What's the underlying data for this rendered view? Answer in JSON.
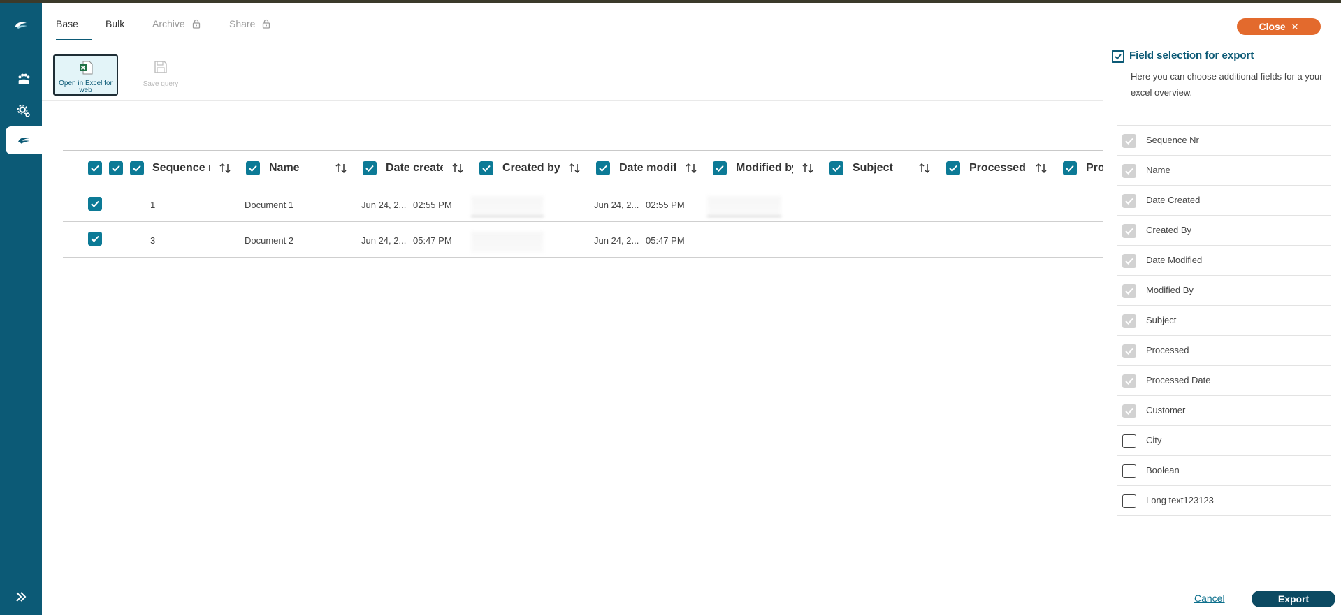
{
  "tabs": [
    {
      "label": "Base",
      "state": "active"
    },
    {
      "label": "Bulk",
      "state": "normal"
    },
    {
      "label": "Archive",
      "state": "locked"
    },
    {
      "label": "Share",
      "state": "locked"
    }
  ],
  "toolbar": {
    "open_excel_label": "Open in Excel for web",
    "save_query_label": "Save query"
  },
  "close_button": {
    "label": "Close",
    "icon": "close-icon"
  },
  "table": {
    "headers": [
      "Sequence n",
      "Name",
      "Date create",
      "Created by",
      "Date modif",
      "Modified by",
      "Subject",
      "Processed",
      "Pro"
    ],
    "rows": [
      {
        "sequence": "1",
        "name": "Document 1",
        "date_created": "Jun 24, 2...",
        "time_created": "02:55 PM",
        "date_modified": "Jun 24, 2...",
        "time_modified": "02:55 PM"
      },
      {
        "sequence": "3",
        "name": "Document 2",
        "date_created": "Jun 24, 2...",
        "time_created": "05:47 PM",
        "date_modified": "Jun 24, 2...",
        "time_modified": "05:47 PM"
      }
    ]
  },
  "panel": {
    "title": "Field selection for export",
    "description": "Here you can choose additional fields for a your excel overview.",
    "fields": [
      {
        "label": "Sequence Nr",
        "checked": true,
        "locked": true
      },
      {
        "label": "Name",
        "checked": true,
        "locked": true
      },
      {
        "label": "Date Created",
        "checked": true,
        "locked": true
      },
      {
        "label": "Created By",
        "checked": true,
        "locked": true
      },
      {
        "label": "Date Modified",
        "checked": true,
        "locked": true
      },
      {
        "label": "Modified By",
        "checked": true,
        "locked": true
      },
      {
        "label": "Subject",
        "checked": true,
        "locked": true
      },
      {
        "label": "Processed",
        "checked": true,
        "locked": true
      },
      {
        "label": "Processed Date",
        "checked": true,
        "locked": true
      },
      {
        "label": "Customer",
        "checked": true,
        "locked": true
      },
      {
        "label": "City",
        "checked": false,
        "locked": false
      },
      {
        "label": "Boolean",
        "checked": false,
        "locked": false
      },
      {
        "label": "Long text123123",
        "checked": false,
        "locked": false
      }
    ],
    "cancel_label": "Cancel",
    "export_label": "Export"
  },
  "colors": {
    "rail": "#0c5a76",
    "accent": "#0c7a96",
    "close": "#e36a2d",
    "export": "#0c4a62"
  }
}
